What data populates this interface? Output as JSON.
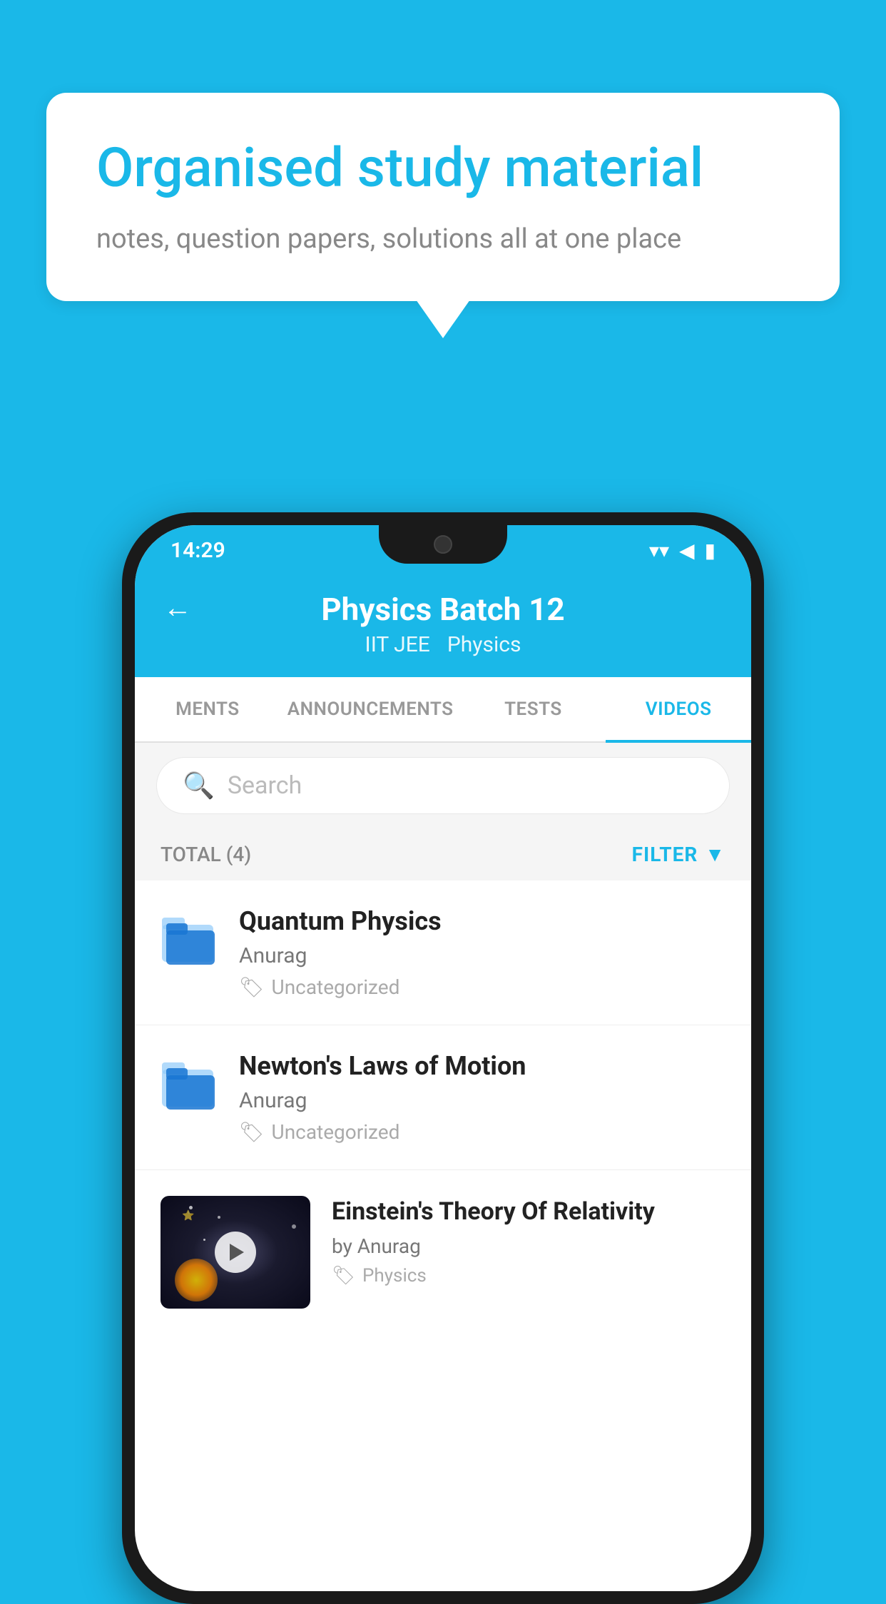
{
  "background": {
    "color": "#1ab8e8"
  },
  "speech_bubble": {
    "title": "Organised study material",
    "subtitle": "notes, question papers, solutions all at one place"
  },
  "status_bar": {
    "time": "14:29",
    "icons": [
      "wifi",
      "signal",
      "battery"
    ]
  },
  "app_header": {
    "back_label": "←",
    "title": "Physics Batch 12",
    "subtitle1": "IIT JEE",
    "subtitle2": "Physics"
  },
  "tabs": [
    {
      "label": "MENTS",
      "active": false
    },
    {
      "label": "ANNOUNCEMENTS",
      "active": false
    },
    {
      "label": "TESTS",
      "active": false
    },
    {
      "label": "VIDEOS",
      "active": true
    }
  ],
  "search": {
    "placeholder": "Search"
  },
  "filter_bar": {
    "total_label": "TOTAL (4)",
    "filter_label": "FILTER"
  },
  "videos": [
    {
      "title": "Quantum Physics",
      "author": "Anurag",
      "tag": "Uncategorized",
      "type": "folder"
    },
    {
      "title": "Newton's Laws of Motion",
      "author": "Anurag",
      "tag": "Uncategorized",
      "type": "folder"
    },
    {
      "title": "Einstein's Theory Of Relativity",
      "author": "by Anurag",
      "tag": "Physics",
      "type": "video"
    }
  ]
}
